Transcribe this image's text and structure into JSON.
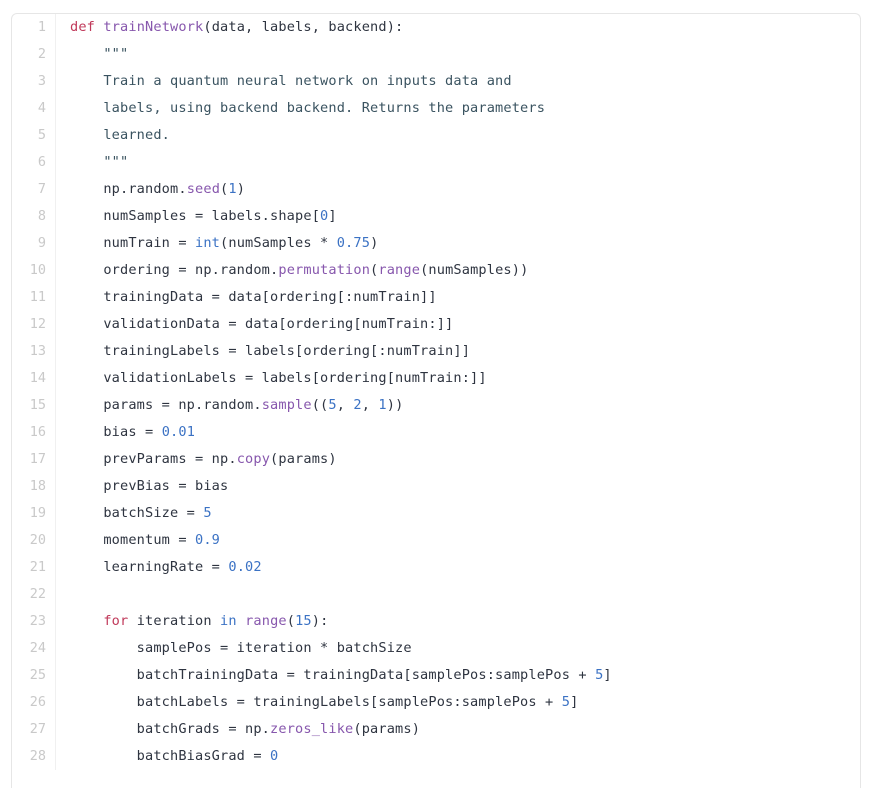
{
  "editor": {
    "language": "python",
    "background_color": "#ffffff",
    "border_color": "#e6e6e6",
    "gutter_color": "#c9c9c9",
    "plain_color": "#2e3440",
    "keyword_color": "#c0395a",
    "function_color": "#8757ad",
    "builtin_color": "#3b72c4",
    "number_color": "#3b72c4",
    "docstring_color": "#3a5360",
    "first_line_number": 1,
    "last_line_number": 28,
    "total_lines_visible": 28
  },
  "lines": [
    {
      "number": "1",
      "text": "def trainNetwork(data, labels, backend):",
      "tokens": [
        {
          "t": "def",
          "c": "kw"
        },
        {
          "t": " ",
          "c": "pl"
        },
        {
          "t": "trainNetwork",
          "c": "fn"
        },
        {
          "t": "(data, labels, backend):",
          "c": "pl"
        }
      ]
    },
    {
      "number": "2",
      "text": "    \"\"\"",
      "tokens": [
        {
          "t": "    ",
          "c": "pl"
        },
        {
          "t": "\"\"\"",
          "c": "doc"
        }
      ]
    },
    {
      "number": "3",
      "text": "    Train a quantum neural network on inputs data and",
      "tokens": [
        {
          "t": "    ",
          "c": "pl"
        },
        {
          "t": "Train a quantum neural network on inputs data and",
          "c": "doc"
        }
      ]
    },
    {
      "number": "4",
      "text": "    labels, using backend backend. Returns the parameters",
      "tokens": [
        {
          "t": "    ",
          "c": "pl"
        },
        {
          "t": "labels, using backend backend. Returns the parameters",
          "c": "doc"
        }
      ]
    },
    {
      "number": "5",
      "text": "    learned.",
      "tokens": [
        {
          "t": "    ",
          "c": "pl"
        },
        {
          "t": "learned.",
          "c": "doc"
        }
      ]
    },
    {
      "number": "6",
      "text": "    \"\"\"",
      "tokens": [
        {
          "t": "    ",
          "c": "pl"
        },
        {
          "t": "\"\"\"",
          "c": "doc"
        }
      ]
    },
    {
      "number": "7",
      "text": "    np.random.seed(1)",
      "tokens": [
        {
          "t": "    np.random.",
          "c": "pl"
        },
        {
          "t": "seed",
          "c": "fn"
        },
        {
          "t": "(",
          "c": "pl"
        },
        {
          "t": "1",
          "c": "num"
        },
        {
          "t": ")",
          "c": "pl"
        }
      ]
    },
    {
      "number": "8",
      "text": "    numSamples = labels.shape[0]",
      "tokens": [
        {
          "t": "    numSamples = labels.shape[",
          "c": "pl"
        },
        {
          "t": "0",
          "c": "num"
        },
        {
          "t": "]",
          "c": "pl"
        }
      ]
    },
    {
      "number": "9",
      "text": "    numTrain = int(numSamples * 0.75)",
      "tokens": [
        {
          "t": "    numTrain = ",
          "c": "pl"
        },
        {
          "t": "int",
          "c": "bi"
        },
        {
          "t": "(numSamples * ",
          "c": "pl"
        },
        {
          "t": "0.75",
          "c": "num"
        },
        {
          "t": ")",
          "c": "pl"
        }
      ]
    },
    {
      "number": "10",
      "text": "    ordering = np.random.permutation(range(numSamples))",
      "tokens": [
        {
          "t": "    ordering = np.random.",
          "c": "pl"
        },
        {
          "t": "permutation",
          "c": "fn"
        },
        {
          "t": "(",
          "c": "pl"
        },
        {
          "t": "range",
          "c": "fn"
        },
        {
          "t": "(numSamples))",
          "c": "pl"
        }
      ]
    },
    {
      "number": "11",
      "text": "    trainingData = data[ordering[:numTrain]]",
      "tokens": [
        {
          "t": "    trainingData = data[ordering[:numTrain]]",
          "c": "pl"
        }
      ]
    },
    {
      "number": "12",
      "text": "    validationData = data[ordering[numTrain:]]",
      "tokens": [
        {
          "t": "    validationData = data[ordering[numTrain:]]",
          "c": "pl"
        }
      ]
    },
    {
      "number": "13",
      "text": "    trainingLabels = labels[ordering[:numTrain]]",
      "tokens": [
        {
          "t": "    trainingLabels = labels[ordering[:numTrain]]",
          "c": "pl"
        }
      ]
    },
    {
      "number": "14",
      "text": "    validationLabels = labels[ordering[numTrain:]]",
      "tokens": [
        {
          "t": "    validationLabels = labels[ordering[numTrain:]]",
          "c": "pl"
        }
      ]
    },
    {
      "number": "15",
      "text": "    params = np.random.sample((5, 2, 1))",
      "tokens": [
        {
          "t": "    params = np.random.",
          "c": "pl"
        },
        {
          "t": "sample",
          "c": "fn"
        },
        {
          "t": "((",
          "c": "pl"
        },
        {
          "t": "5",
          "c": "num"
        },
        {
          "t": ", ",
          "c": "pl"
        },
        {
          "t": "2",
          "c": "num"
        },
        {
          "t": ", ",
          "c": "pl"
        },
        {
          "t": "1",
          "c": "num"
        },
        {
          "t": "))",
          "c": "pl"
        }
      ]
    },
    {
      "number": "16",
      "text": "    bias = 0.01",
      "tokens": [
        {
          "t": "    bias = ",
          "c": "pl"
        },
        {
          "t": "0.01",
          "c": "num"
        }
      ]
    },
    {
      "number": "17",
      "text": "    prevParams = np.copy(params)",
      "tokens": [
        {
          "t": "    prevParams = np.",
          "c": "pl"
        },
        {
          "t": "copy",
          "c": "fn"
        },
        {
          "t": "(params)",
          "c": "pl"
        }
      ]
    },
    {
      "number": "18",
      "text": "    prevBias = bias",
      "tokens": [
        {
          "t": "    prevBias = bias",
          "c": "pl"
        }
      ]
    },
    {
      "number": "19",
      "text": "    batchSize = 5",
      "tokens": [
        {
          "t": "    batchSize = ",
          "c": "pl"
        },
        {
          "t": "5",
          "c": "num"
        }
      ]
    },
    {
      "number": "20",
      "text": "    momentum = 0.9",
      "tokens": [
        {
          "t": "    momentum = ",
          "c": "pl"
        },
        {
          "t": "0.9",
          "c": "num"
        }
      ]
    },
    {
      "number": "21",
      "text": "    learningRate = 0.02",
      "tokens": [
        {
          "t": "    learningRate = ",
          "c": "pl"
        },
        {
          "t": "0.02",
          "c": "num"
        }
      ]
    },
    {
      "number": "22",
      "text": "",
      "tokens": []
    },
    {
      "number": "23",
      "text": "    for iteration in range(15):",
      "tokens": [
        {
          "t": "    ",
          "c": "pl"
        },
        {
          "t": "for",
          "c": "kw"
        },
        {
          "t": " iteration ",
          "c": "pl"
        },
        {
          "t": "in",
          "c": "bi"
        },
        {
          "t": " ",
          "c": "pl"
        },
        {
          "t": "range",
          "c": "fn"
        },
        {
          "t": "(",
          "c": "pl"
        },
        {
          "t": "15",
          "c": "num"
        },
        {
          "t": "):",
          "c": "pl"
        }
      ]
    },
    {
      "number": "24",
      "text": "        samplePos = iteration * batchSize",
      "tokens": [
        {
          "t": "        samplePos = iteration * batchSize",
          "c": "pl"
        }
      ]
    },
    {
      "number": "25",
      "text": "        batchTrainingData = trainingData[samplePos:samplePos + 5]",
      "tokens": [
        {
          "t": "        batchTrainingData = trainingData[samplePos:samplePos + ",
          "c": "pl"
        },
        {
          "t": "5",
          "c": "num"
        },
        {
          "t": "]",
          "c": "pl"
        }
      ]
    },
    {
      "number": "26",
      "text": "        batchLabels = trainingLabels[samplePos:samplePos + 5]",
      "tokens": [
        {
          "t": "        batchLabels = trainingLabels[samplePos:samplePos + ",
          "c": "pl"
        },
        {
          "t": "5",
          "c": "num"
        },
        {
          "t": "]",
          "c": "pl"
        }
      ]
    },
    {
      "number": "27",
      "text": "        batchGrads = np.zeros_like(params)",
      "tokens": [
        {
          "t": "        batchGrads = np.",
          "c": "pl"
        },
        {
          "t": "zeros_like",
          "c": "fn"
        },
        {
          "t": "(params)",
          "c": "pl"
        }
      ]
    },
    {
      "number": "28",
      "text": "        batchBiasGrad = 0",
      "tokens": [
        {
          "t": "        batchBiasGrad = ",
          "c": "pl"
        },
        {
          "t": "0",
          "c": "num"
        }
      ]
    }
  ]
}
